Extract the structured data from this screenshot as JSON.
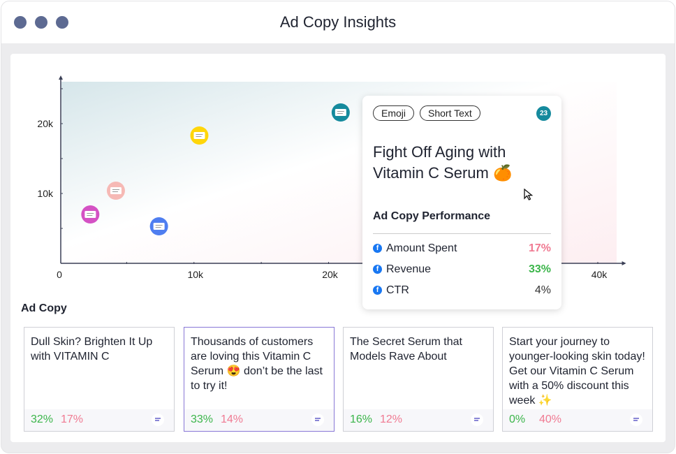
{
  "window": {
    "title": "Ad Copy Insights"
  },
  "chart_data": {
    "type": "scatter",
    "x_ticks": [
      "0",
      "10k",
      "20k",
      "40k"
    ],
    "y_ticks": [
      "10k",
      "20k"
    ],
    "xlim": [
      0,
      42000
    ],
    "ylim": [
      0,
      26700
    ],
    "points": [
      {
        "x": 2300,
        "y": 7000,
        "color": "#d452c4"
      },
      {
        "x": 4200,
        "y": 10400,
        "color": "#f6b9b5"
      },
      {
        "x": 7400,
        "y": 5300,
        "color": "#4f7ef0"
      },
      {
        "x": 10400,
        "y": 18300,
        "color": "#ffd60a"
      },
      {
        "x": 20900,
        "y": 21600,
        "color": "#158a9d"
      }
    ]
  },
  "tooltip": {
    "tags": [
      "Emoji",
      "Short Text"
    ],
    "badge": "23",
    "title": "Fight Off Aging with Vitamin C Serum 🍊",
    "section": "Ad Copy Performance",
    "metrics": [
      {
        "label": "Amount Spent",
        "value": "17%",
        "color": "#f07a92",
        "icon": "facebook-icon"
      },
      {
        "label": "Revenue",
        "value": "33%",
        "color": "#3bb54a",
        "icon": "facebook-icon"
      },
      {
        "label": "CTR",
        "value": "4%",
        "color": "#333333",
        "icon": "facebook-icon"
      }
    ]
  },
  "ad_copy": {
    "heading": "Ad Copy",
    "cards": [
      {
        "text": "Dull Skin? Brighten It Up with VITAMIN C",
        "m1": "32%",
        "m2": "17%"
      },
      {
        "text": "Thousands of customers are loving this Vitamin C Serum 😍 don’t be the last to try it!",
        "m1": "33%",
        "m2": "14%",
        "selected": true
      },
      {
        "text": "The Secret Serum that Models Rave About",
        "m1": "16%",
        "m2": "12%"
      },
      {
        "text": "Start your journey to younger-looking skin today! Get our Vitamin C Serum with a 50% discount this week ✨",
        "m1": "0%",
        "m2": "40%"
      }
    ]
  }
}
